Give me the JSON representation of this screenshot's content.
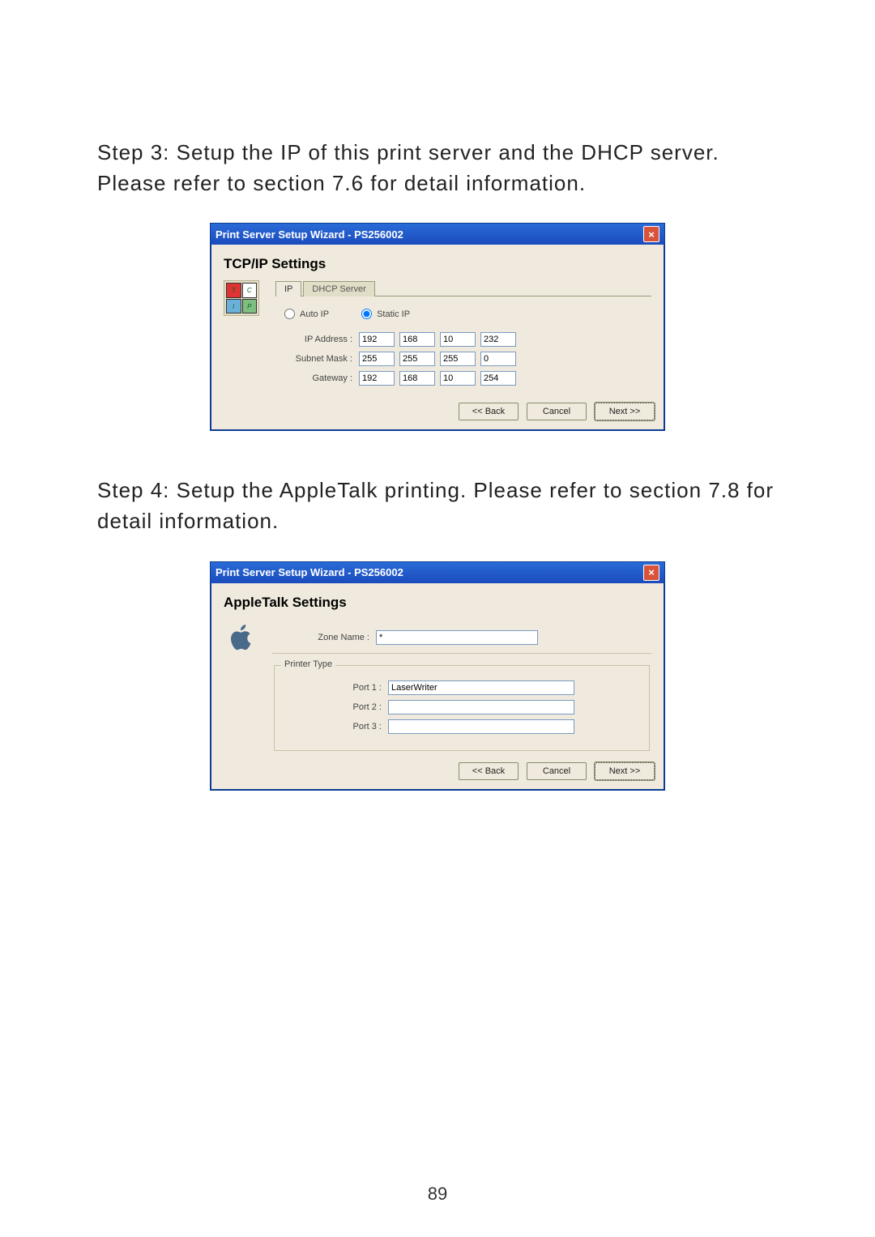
{
  "page_number": "89",
  "step3_text": "Step 3: Setup the IP of this print server and the DHCP server. Please refer to section 7.6 for detail information.",
  "step4_text": "Step 4: Setup the AppleTalk printing. Please refer to section 7.8 for detail information.",
  "dialog_title": "Print Server Setup Wizard - PS256002",
  "close_glyph": "×",
  "tcpip": {
    "heading": "TCP/IP Settings",
    "tab_ip": "IP",
    "tab_dhcp": "DHCP Server",
    "radio_auto": "Auto IP",
    "radio_static": "Static IP",
    "label_ipaddress": "IP Address :",
    "label_subnet": "Subnet Mask :",
    "label_gateway": "Gateway :",
    "ip": [
      "192",
      "168",
      "10",
      "232"
    ],
    "subnet": [
      "255",
      "255",
      "255",
      "0"
    ],
    "gateway": [
      "192",
      "168",
      "10",
      "254"
    ]
  },
  "appletalk": {
    "heading": "AppleTalk Settings",
    "zone_label": "Zone Name :",
    "zone_value": "*",
    "group_label": "Printer Type",
    "port1_label": "Port 1 :",
    "port1_value": "LaserWriter",
    "port2_label": "Port 2 :",
    "port2_value": "",
    "port3_label": "Port 3 :",
    "port3_value": ""
  },
  "buttons": {
    "back": "<< Back",
    "cancel": "Cancel",
    "next": "Next >>"
  }
}
